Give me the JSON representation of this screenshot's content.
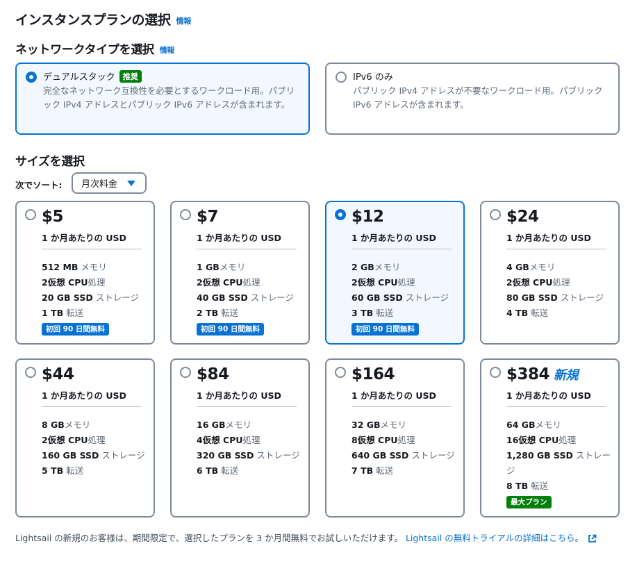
{
  "title": "インスタンスプランの選択",
  "info_label": "情報",
  "network": {
    "heading": "ネットワークタイプを選択",
    "info_label": "情報",
    "options": [
      {
        "label": "デュアルスタック",
        "badge": "推奨",
        "selected": true,
        "description": "完全なネットワーク互換性を必要とするワークロード用。パブリック IPv4 アドレスとパブリック IPv6 アドレスが含まれます。"
      },
      {
        "label": "IPv6 のみ",
        "badge": "",
        "selected": false,
        "description": "パブリック IPv4 アドレスが不要なワークロード用。パブリック IPv6 アドレスが含まれます。"
      }
    ]
  },
  "size": {
    "heading": "サイズを選択",
    "sort_label": "次でソート:",
    "sort_value": "月次料金",
    "per_month": "1 か月あたりの USD",
    "plans": [
      {
        "price": "$5",
        "new": "",
        "selected": false,
        "mem_val": "512 MB",
        "mem_unit": " メモリ",
        "cpu_val": "2仮想 CPU",
        "cpu_unit": "処理",
        "ssd_val": "20 GB SSD",
        "ssd_unit": " ストレージ",
        "tx_val": "1 TB",
        "tx_unit": " 転送",
        "promo": "初回 90 日間無料",
        "promo_color": "blue"
      },
      {
        "price": "$7",
        "new": "",
        "selected": false,
        "mem_val": "1 GB",
        "mem_unit": "メモリ",
        "cpu_val": "2仮想 CPU",
        "cpu_unit": "処理",
        "ssd_val": "40 GB SSD",
        "ssd_unit": " ストレージ",
        "tx_val": "2 TB",
        "tx_unit": " 転送",
        "promo": "初回 90 日間無料",
        "promo_color": "blue"
      },
      {
        "price": "$12",
        "new": "",
        "selected": true,
        "mem_val": "2 GB",
        "mem_unit": "メモリ",
        "cpu_val": "2仮想 CPU",
        "cpu_unit": "処理",
        "ssd_val": "60 GB SSD",
        "ssd_unit": " ストレージ",
        "tx_val": "3 TB",
        "tx_unit": " 転送",
        "promo": "初回 90 日間無料",
        "promo_color": "blue"
      },
      {
        "price": "$24",
        "new": "",
        "selected": false,
        "mem_val": "4 GB",
        "mem_unit": "メモリ",
        "cpu_val": "2仮想 CPU",
        "cpu_unit": "処理",
        "ssd_val": "80 GB SSD",
        "ssd_unit": " ストレージ",
        "tx_val": "4 TB",
        "tx_unit": " 転送",
        "promo": "",
        "promo_color": ""
      },
      {
        "price": "$44",
        "new": "",
        "selected": false,
        "mem_val": "8 GB",
        "mem_unit": "メモリ",
        "cpu_val": "2仮想 CPU",
        "cpu_unit": "処理",
        "ssd_val": "160 GB SSD",
        "ssd_unit": " ストレージ",
        "tx_val": "5 TB",
        "tx_unit": " 転送",
        "promo": "",
        "promo_color": ""
      },
      {
        "price": "$84",
        "new": "",
        "selected": false,
        "mem_val": "16 GB",
        "mem_unit": "メモリ",
        "cpu_val": "4仮想 CPU",
        "cpu_unit": "処理",
        "ssd_val": "320 GB SSD",
        "ssd_unit": " ストレージ",
        "tx_val": "6 TB",
        "tx_unit": " 転送",
        "promo": "",
        "promo_color": ""
      },
      {
        "price": "$164",
        "new": "",
        "selected": false,
        "mem_val": "32 GB",
        "mem_unit": "メモリ",
        "cpu_val": "8仮想 CPU",
        "cpu_unit": "処理",
        "ssd_val": "640 GB SSD",
        "ssd_unit": " ストレージ",
        "tx_val": "7 TB",
        "tx_unit": " 転送",
        "promo": "",
        "promo_color": ""
      },
      {
        "price": "$384",
        "new": "新規",
        "selected": false,
        "mem_val": "64 GB",
        "mem_unit": "メモリ",
        "cpu_val": "16仮想 CPU",
        "cpu_unit": "処理",
        "ssd_val": "1,280 GB SSD",
        "ssd_unit": " ストレージ",
        "tx_val": "8 TB",
        "tx_unit": " 転送",
        "promo": "最大プラン",
        "promo_color": "green"
      }
    ]
  },
  "footer": {
    "text": "Lightsail の新規のお客様は、期間限定で、選択したプランを 3 か月間無料でお試しいただけます。",
    "link": "Lightsail の無料トライアルの詳細はこちら。",
    "link_icon": "external-link-icon"
  },
  "colors": {
    "accent": "#0972d3",
    "green": "#037f0c",
    "selected_bg": "#f1f8ff"
  }
}
